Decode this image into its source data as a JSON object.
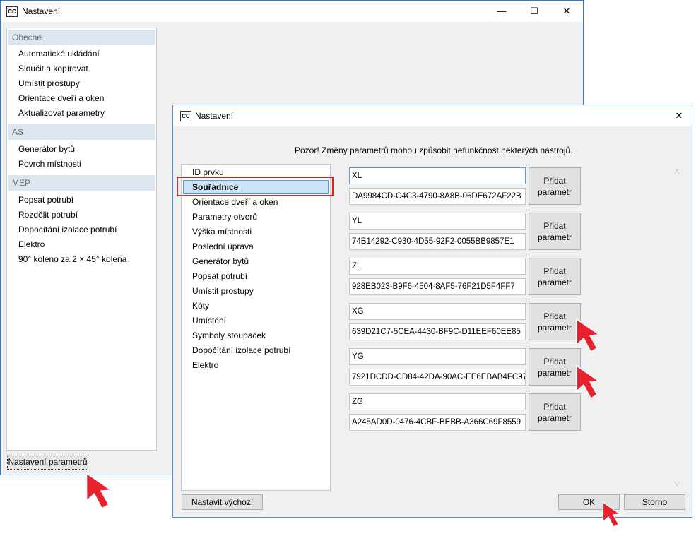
{
  "back_window": {
    "app_icon": "CC",
    "title": "Nastavení",
    "caption": {
      "minimize": "—",
      "maximize": "☐",
      "close": "✕"
    },
    "groups": [
      {
        "header": "Obecné",
        "items": [
          "Automatické ukládání",
          "Sloučit a kopírovat",
          "Umístit prostupy",
          "Orientace dveří a oken",
          "Aktualizovat parametry"
        ]
      },
      {
        "header": "AS",
        "items": [
          "Generátor bytů",
          "Povrch místnosti"
        ]
      },
      {
        "header": "MEP",
        "items": [
          "Popsat potrubí",
          "Rozdělit potrubí",
          "Dopočítání izolace potrubí",
          "Elektro",
          "90° koleno za 2 × 45° kolena"
        ]
      }
    ],
    "settings_button": "Nastavení parametrů"
  },
  "front_window": {
    "app_icon": "CC",
    "title": "Nastavení",
    "close": "✕",
    "warning": "Pozor! Změny parametrů mohou způsobit nefunkčnost některých nástrojů.",
    "list": [
      "ID prvku",
      "Souřadnice",
      "Orientace dveří a oken",
      "Parametry otvorů",
      "Výška místnosti",
      "Poslední úprava",
      "Generátor bytů",
      "Popsat potrubí",
      "Umístit prostupy",
      "Kóty",
      "Umístění",
      "Symboly stoupaček",
      "Dopočítání izolace potrubí",
      "Elektro"
    ],
    "selected_index": 1,
    "params": [
      {
        "name": "XL",
        "guid": "DA9984CD-C4C3-4790-8A8B-06DE672AF22B"
      },
      {
        "name": "YL",
        "guid": "74B14292-C930-4D55-92F2-0055BB9857E1"
      },
      {
        "name": "ZL",
        "guid": "928EB023-B9F6-4504-8AF5-76F21D5F4FF7"
      },
      {
        "name": "XG",
        "guid": "639D21C7-5CEA-4430-BF9C-D11EEF60EE85"
      },
      {
        "name": "YG",
        "guid": "7921DCDD-CD84-42DA-90AC-EE6EBAB4FC97"
      },
      {
        "name": "ZG",
        "guid": "A245AD0D-0476-4CBF-BEBB-A366C69F8559"
      }
    ],
    "add_button": {
      "line1": "Přidat",
      "line2": "parametr"
    },
    "scroll": {
      "up": "˄",
      "down": "˅"
    },
    "default_button": "Nastavit výchozí",
    "ok_button": "OK",
    "cancel_button": "Storno"
  },
  "colors": {
    "highlight": "#e32020",
    "arrow": "#e8222c",
    "selection": "#cce4f7",
    "header_bg": "#dce5f0"
  }
}
